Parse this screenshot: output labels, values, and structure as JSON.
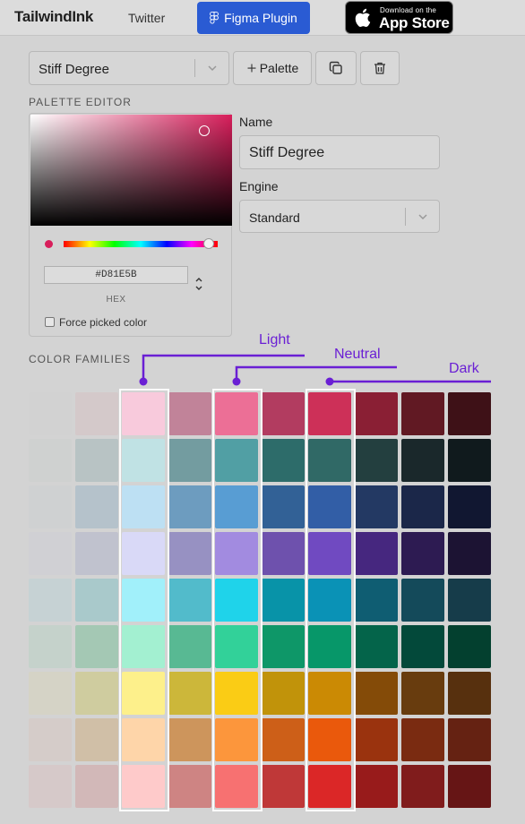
{
  "topbar": {
    "logo": "TailwindInk",
    "twitter": "Twitter",
    "figma_plugin": "Figma Plugin",
    "appstore_small": "Download on the",
    "appstore_big": "App Store"
  },
  "toolbar": {
    "palette_select_value": "Stiff Degree",
    "add_palette_label": "Palette",
    "duplicate_icon": "copy-icon",
    "delete_icon": "trash-icon"
  },
  "editor": {
    "section_label": "PALETTE EDITOR",
    "hex_value": "#D81E5B",
    "hex_label": "HEX",
    "force_picked_label": "Force picked color",
    "force_picked_checked": false,
    "name_label": "Name",
    "name_value": "Stiff Degree",
    "engine_label": "Engine",
    "engine_value": "Standard",
    "picked_color": "#d81e5b"
  },
  "families": {
    "section_label": "COLOR FAMILIES",
    "annotations": {
      "light": "Light",
      "neutral": "Neutral",
      "dark": "Dark"
    },
    "rows": [
      [
        "#d2d2d2",
        "#d4c9ca",
        "#f8cadc",
        "#c18399",
        "#ec6f96",
        "#b23c60",
        "#cd3058",
        "#8a1f34",
        "#611923",
        "#3e1117"
      ],
      [
        "#cfd1d0",
        "#b8c3c4",
        "#c0e2e4",
        "#739ca0",
        "#519fa4",
        "#2d6c6a",
        "#306966",
        "#233f3f",
        "#1a282b",
        "#101a1d"
      ],
      [
        "#cfd1d2",
        "#b5c2cb",
        "#bde0f3",
        "#6d9cbf",
        "#589dd3",
        "#326196",
        "#325ea6",
        "#233963",
        "#1b2749",
        "#111731"
      ],
      [
        "#d0d0d4",
        "#c0c2ce",
        "#d9d9f7",
        "#9791c2",
        "#a28be0",
        "#6e51ad",
        "#704ac1",
        "#46277f",
        "#2d1b52",
        "#1c1333"
      ],
      [
        "#c6d2d4",
        "#a9c9cb",
        "#a1f0fa",
        "#52bbcb",
        "#1fd3ea",
        "#0893a8",
        "#0a92b6",
        "#0f5d72",
        "#144a5a",
        "#163c4a"
      ],
      [
        "#c5d2cb",
        "#a4c8b4",
        "#a3f0d1",
        "#58b993",
        "#32d199",
        "#0e9768",
        "#079769",
        "#04644a",
        "#03493a",
        "#03402f"
      ],
      [
        "#d5d3c6",
        "#cfcc9f",
        "#fdf08b",
        "#ccb73a",
        "#facc15",
        "#c1930a",
        "#cb8a04",
        "#844b08",
        "#683c0e",
        "#57300e"
      ],
      [
        "#d5ccc9",
        "#d0bfa7",
        "#fed5a9",
        "#cd955c",
        "#fc963c",
        "#cd5f18",
        "#ea590c",
        "#9a330e",
        "#7a2b11",
        "#652212"
      ],
      [
        "#d6c9c9",
        "#d2b8b8",
        "#fecaca",
        "#ce8483",
        "#f77171",
        "#bf3838",
        "#db2727",
        "#981b1b",
        "#801c1c",
        "#661515"
      ]
    ]
  }
}
